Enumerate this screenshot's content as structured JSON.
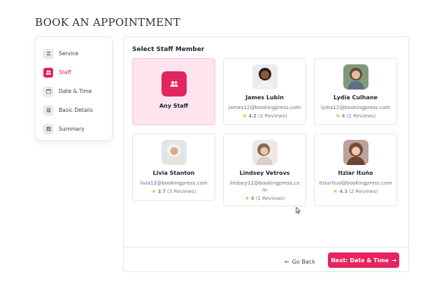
{
  "page": {
    "title": "BOOK AN APPOINTMENT"
  },
  "sidebar": {
    "items": [
      {
        "label": "Service",
        "icon": "service-icon",
        "active": false
      },
      {
        "label": "Staff",
        "icon": "staff-icon",
        "active": true
      },
      {
        "label": "Date & Time",
        "icon": "calendar-icon",
        "active": false
      },
      {
        "label": "Basic Details",
        "icon": "form-icon",
        "active": false
      },
      {
        "label": "Summary",
        "icon": "checklist-icon",
        "active": false
      }
    ]
  },
  "main": {
    "title": "Select Staff Member",
    "any_staff": {
      "label": "Any Staff",
      "icon": "group-icon"
    },
    "staff": [
      {
        "name": "James Lubin",
        "email": "james12@bookingpress.com",
        "rating": "4.2",
        "reviews": "(3 Reviews)"
      },
      {
        "name": "Lydia Culhane",
        "email": "lydia12@bookingpress.com",
        "rating": "4",
        "reviews": "(2 Reviews)"
      },
      {
        "name": "Livia Stanton",
        "email": "livia12@bookingpress.com",
        "rating": "3.7",
        "reviews": "(3 Reviews)"
      },
      {
        "name": "Lindsey Vetrovs",
        "email": "lindsey12@bookingpress.com",
        "rating": "4",
        "reviews": "(1 Reviews)"
      },
      {
        "name": "Itziar Ituño",
        "email": "itziarituo@bookingpress.com",
        "rating": "4.3",
        "reviews": "(2 Reviews)"
      }
    ]
  },
  "footer": {
    "back_label": "Go Back",
    "next_label": "Next: Date & Time"
  },
  "colors": {
    "accent": "#e3245f",
    "accent_light": "#fde4ee",
    "star": "#f2b53a"
  }
}
